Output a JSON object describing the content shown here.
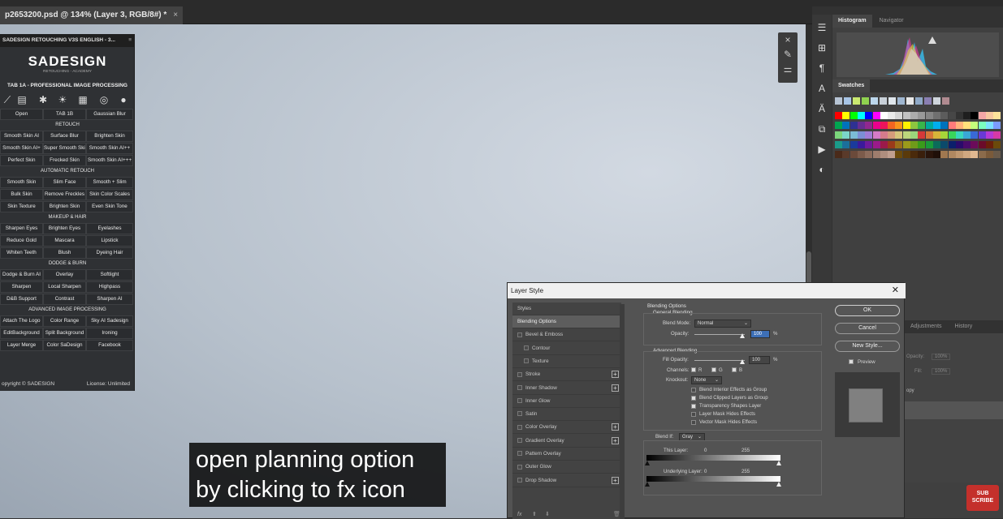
{
  "document_tab": {
    "title": "p2653200.psd @ 134% (Layer 3, RGB/8#) *",
    "close": "×"
  },
  "right_panels": {
    "tabs_top": [
      "Histogram",
      "Navigator"
    ],
    "tabs_swatches": [
      "Swatches"
    ],
    "tabs_bottom": [
      "Adjustments",
      "History"
    ]
  },
  "colors": {
    "swatches_recent": [
      "#b7c4d4",
      "#a8c5e6",
      "#c9e870",
      "#8fd14f",
      "#bcd7ec",
      "#c8d0d8",
      "#dfe6ec",
      "#9fb6d0",
      "#e9e9e9",
      "#8fa9c7",
      "#8a7fb2",
      "#cfd5dc",
      "#b08a90"
    ],
    "swatches_grid": [
      [
        "#ff0000",
        "#ffff00",
        "#00ff00",
        "#00ffff",
        "#0000ff",
        "#ff00ff",
        "#ffffff",
        "#ebebeb",
        "#d6d6d6",
        "#c2c2c2",
        "#adadad",
        "#999999",
        "#858585",
        "#707070",
        "#5c5c5c",
        "#474747",
        "#333333",
        "#1f1f1f",
        "#000000",
        "#f4a7a7",
        "#f7c8a0",
        "#fde39a"
      ],
      [
        "#00a651",
        "#0072bc",
        "#2e3192",
        "#662d91",
        "#92278f",
        "#ec008c",
        "#ed145b",
        "#f26522",
        "#f7941d",
        "#fff200",
        "#8dc63f",
        "#39b54a",
        "#00a99d",
        "#00aeef",
        "#0072bc",
        "#ff7b7b",
        "#ffb27b",
        "#ffe07b",
        "#c4ff7b",
        "#7bffbe",
        "#7be1ff",
        "#7b9bff"
      ],
      [
        "#7bd67b",
        "#7bd6c9",
        "#7bbcd6",
        "#7b8fd6",
        "#a17bd6",
        "#d67bc7",
        "#d67b8c",
        "#d69b7b",
        "#d6c47b",
        "#bcd67b",
        "#9bd67b",
        "#d63939",
        "#d67739",
        "#d6b539",
        "#a7d639",
        "#39d65a",
        "#39d6bc",
        "#39a7d6",
        "#3969d6",
        "#6939d6",
        "#b539d6",
        "#d639a7"
      ],
      [
        "#1a9b8a",
        "#1a6f9b",
        "#1a3a9b",
        "#3a1a9b",
        "#6f1a9b",
        "#9b1a8a",
        "#9b1a4a",
        "#9b3a1a",
        "#9b6f1a",
        "#9b9b1a",
        "#6f9b1a",
        "#3a9b1a",
        "#1a9b3a",
        "#0b6b5a",
        "#0b4a6b",
        "#0b1f6b",
        "#2a0b6b",
        "#4a0b6b",
        "#6b0b5a",
        "#6b0b2a",
        "#6b1f0b",
        "#6b4a0b"
      ],
      [
        "#4a2a1a",
        "#5a3a2a",
        "#6b4a3a",
        "#7c5b4b",
        "#8d6c5c",
        "#9e7d6d",
        "#af8e7e",
        "#c09f8f",
        "#6b4a0b",
        "#5a3a0b",
        "#4a2a0b",
        "#3a1f0b",
        "#2a150b",
        "#1f0f08",
        "#a07850",
        "#b08860",
        "#c09870",
        "#d0a880",
        "#e0b890",
        "#8b6b4b",
        "#7a5a3a",
        "#695a4a"
      ]
    ],
    "subscribe": "#c4302b",
    "dialog_bg": "#535353"
  },
  "sadesign": {
    "title": "SADESIGN RETOUCHING V3S ENGLISH - 3...",
    "brand": "SADESIGN",
    "brand_sub": "RETOUCHING - ACADEMY",
    "tab_label": "TAB 1A - PROFESSIONAL IMAGE PROCESSING",
    "icons": [
      "brush-icon",
      "document-icon",
      "gear-icon",
      "sun-icon",
      "printer-icon",
      "aperture-icon",
      "user-icon"
    ],
    "row_open": [
      "Open",
      "TAB 1B",
      "Gaussian Blur"
    ],
    "h_retouch": "RETOUCH",
    "retouch_rows": [
      [
        "Smooth Skin AI",
        "Surface Blur",
        "Brighten Skin"
      ],
      [
        "Smooth Skin AI+",
        "Super Smooth Skin",
        "Smooth Skin AI++"
      ],
      [
        "Perfect Skin",
        "Frecked Skin",
        "Smooth Skin AI+++"
      ]
    ],
    "h_auto": "AUTOMATIC RETOUCH",
    "auto_rows": [
      [
        "Smooth Skin",
        "Slim Face",
        "Smooth + Slim"
      ],
      [
        "Bulk Skin",
        "Remove Freckles",
        "Skin Color Scales"
      ],
      [
        "Skin Texture",
        "Brighten Skin",
        "Even Skin Tone"
      ]
    ],
    "h_makeup": "MAKEUP & HAIR",
    "makeup_rows": [
      [
        "Sharpen Eyes",
        "Brighten Eyes",
        "Eyelashes"
      ],
      [
        "Reduce Gold",
        "Mascara",
        "Lipstick"
      ],
      [
        "Whiten Teeth",
        "Blush",
        "Dyeing Hair"
      ]
    ],
    "h_dodge": "DODGE & BURN",
    "dodge_rows": [
      [
        "Dodge & Burn AI",
        "Overlay",
        "Softlight"
      ],
      [
        "Sharpen",
        "Local Sharpen",
        "Highpass"
      ],
      [
        "D&B Support",
        "Contrast",
        "Sharpen AI"
      ]
    ],
    "h_adv": "ADVANCED IMAGE PROCESSING",
    "adv_rows": [
      [
        "Attach The Logo",
        "Color Range",
        "Sky AI Sadesign"
      ],
      [
        "EditBackground",
        "Split Background",
        "Ironing"
      ],
      [
        "Layer Merge",
        "Color SaDesign",
        "Facebook"
      ]
    ],
    "footer_left": "opyright © SADESIGN",
    "footer_right": "License: Unlimited"
  },
  "layer_style": {
    "title": "Layer Style",
    "styles_header": "Styles",
    "items": [
      {
        "label": "Blending Options",
        "active": true
      },
      {
        "label": "Bevel & Emboss",
        "cb": true
      },
      {
        "label": "Contour",
        "cb": true,
        "indent": true
      },
      {
        "label": "Texture",
        "cb": true,
        "indent": true
      },
      {
        "label": "Stroke",
        "cb": true,
        "plus": true
      },
      {
        "label": "Inner Shadow",
        "cb": true,
        "plus": true
      },
      {
        "label": "Inner Glow",
        "cb": true
      },
      {
        "label": "Satin",
        "cb": true
      },
      {
        "label": "Color Overlay",
        "cb": true,
        "plus": true
      },
      {
        "label": "Gradient Overlay",
        "cb": true,
        "plus": true
      },
      {
        "label": "Pattern Overlay",
        "cb": true
      },
      {
        "label": "Outer Glow",
        "cb": true
      },
      {
        "label": "Drop Shadow",
        "cb": true,
        "plus": true
      }
    ],
    "footer_fx": "fx",
    "blending_options": "Blending Options",
    "general_blending": "General Blending",
    "blend_mode_label": "Blend Mode:",
    "blend_mode_value": "Normal",
    "opacity_label": "Opacity:",
    "opacity_value": "100",
    "pct": "%",
    "advanced_blending": "Advanced Blending",
    "fill_opacity_label": "Fill Opacity:",
    "fill_opacity_value": "100",
    "channels_label": "Channels:",
    "ch_r": "R",
    "ch_g": "G",
    "ch_b": "B",
    "knockout_label": "Knockout:",
    "knockout_value": "None",
    "options": [
      {
        "label": "Blend Interior Effects as Group",
        "checked": false
      },
      {
        "label": "Blend Clipped Layers as Group",
        "checked": true
      },
      {
        "label": "Transparency Shapes Layer",
        "checked": true
      },
      {
        "label": "Layer Mask Hides Effects",
        "checked": false
      },
      {
        "label": "Vector Mask Hides Effects",
        "checked": false
      }
    ],
    "blend_if_label": "Blend If:",
    "blend_if_value": "Gray",
    "this_layer_label": "This Layer:",
    "this_layer_min": "0",
    "this_layer_max": "255",
    "underlying_label": "Underlying Layer:",
    "underlying_min": "0",
    "underlying_max": "255",
    "ok": "OK",
    "cancel": "Cancel",
    "new_style": "New Style...",
    "preview_label": "Preview"
  },
  "layers_panel": {
    "opacity_label": "Opacity:",
    "opacity_value": "100%",
    "fill_label": "Fill:",
    "fill_value": "100%",
    "layer_name": "opy"
  },
  "subtitles": [
    "open planning option",
    "by clicking to fx icon"
  ],
  "subscribe": {
    "line1": "SUB",
    "line2": "SCRIBE"
  }
}
